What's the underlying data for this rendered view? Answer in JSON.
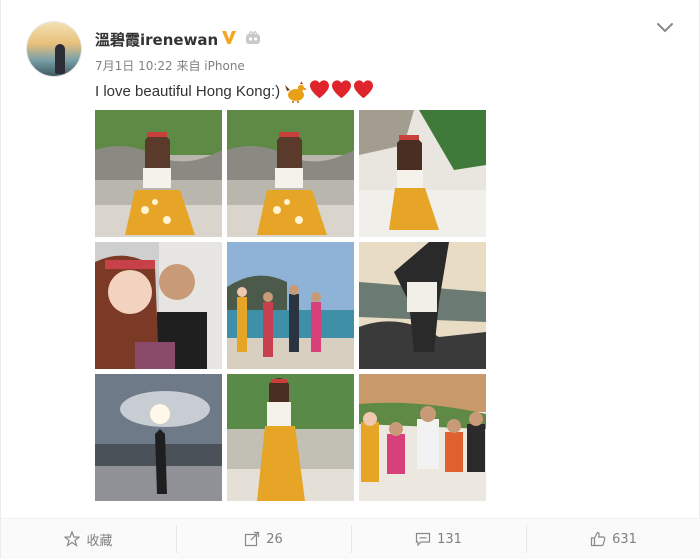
{
  "post": {
    "author": "溫碧霞irenewan",
    "meta": "7月1日 10:22 来自 iPhone",
    "text": "I love beautiful Hong Kong:)"
  },
  "icons": {
    "verified": "verified-v-badge-icon",
    "member": "member-crown-icon",
    "expand": "chevron-down-icon",
    "rooster": "rooster-emoji",
    "hearts": [
      "heart-emoji",
      "heart-emoji",
      "heart-emoji"
    ]
  },
  "photos": [
    {
      "alt": "woman sitting on rocks in yellow skirt"
    },
    {
      "alt": "woman sitting on rocks in yellow skirt"
    },
    {
      "alt": "woman sitting on sand near rocks"
    },
    {
      "alt": "selfie of two people"
    },
    {
      "alt": "group posing on beach"
    },
    {
      "alt": "silhouette on rocks at sunset"
    },
    {
      "alt": "silhouette on beach under cloudy sky"
    },
    {
      "alt": "woman standing by rocks"
    },
    {
      "alt": "group sitting on beach"
    }
  ],
  "footer": {
    "favorite_label": "收藏",
    "repost_count": "26",
    "comment_count": "131",
    "like_count": "631"
  },
  "colors": {
    "verified": "#f5a623",
    "heart": "#e0242b",
    "muted_text": "#808080"
  }
}
